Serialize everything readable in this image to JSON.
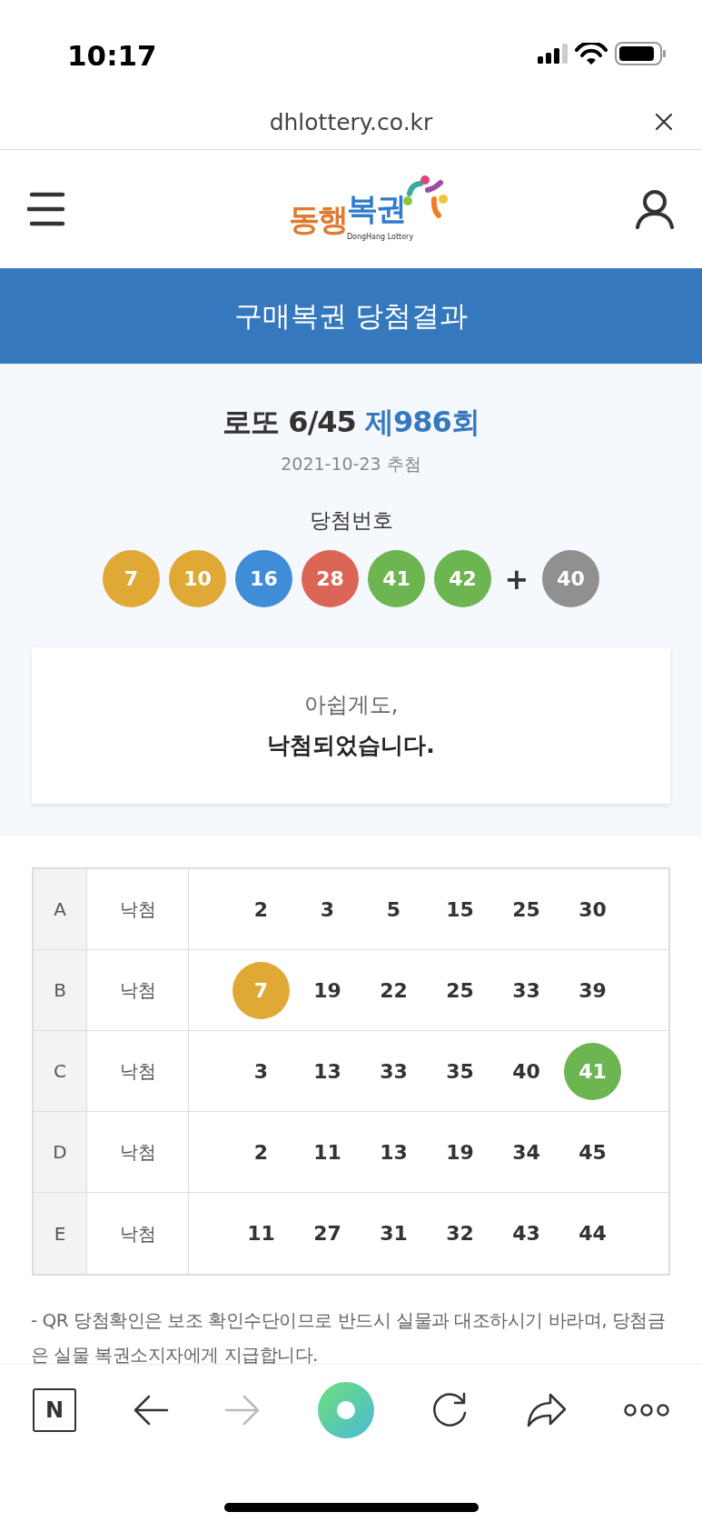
{
  "status_bar": {
    "time": "10:17"
  },
  "browser": {
    "url": "dhlottery.co.kr"
  },
  "header": {
    "logo_part_1": "동행",
    "logo_part_2": "복권",
    "logo_subtitle": "DongHang Lottery"
  },
  "banner": {
    "title": "구매복권 당첨결과"
  },
  "result": {
    "game": "로또 6/45",
    "round": "제986회",
    "date": "2021-10-23 추첨",
    "numbers_label": "당첨번호",
    "balls": [
      {
        "value": "7",
        "color": "#e0a935"
      },
      {
        "value": "10",
        "color": "#e0a935"
      },
      {
        "value": "16",
        "color": "#3f8dd6"
      },
      {
        "value": "28",
        "color": "#dc6656"
      },
      {
        "value": "41",
        "color": "#6db551"
      },
      {
        "value": "42",
        "color": "#6db551"
      }
    ],
    "plus": "+",
    "bonus": {
      "value": "40",
      "color": "#909090"
    },
    "message_line_1": "아쉽게도,",
    "message_line_2": "낙첨되었습니다."
  },
  "tickets": [
    {
      "game": "A",
      "status": "낙첨",
      "numbers": [
        {
          "value": "2",
          "matched": false
        },
        {
          "value": "3",
          "matched": false
        },
        {
          "value": "5",
          "matched": false
        },
        {
          "value": "15",
          "matched": false
        },
        {
          "value": "25",
          "matched": false
        },
        {
          "value": "30",
          "matched": false
        }
      ]
    },
    {
      "game": "B",
      "status": "낙첨",
      "numbers": [
        {
          "value": "7",
          "matched": true,
          "color": "#e0a935"
        },
        {
          "value": "19",
          "matched": false
        },
        {
          "value": "22",
          "matched": false
        },
        {
          "value": "25",
          "matched": false
        },
        {
          "value": "33",
          "matched": false
        },
        {
          "value": "39",
          "matched": false
        }
      ]
    },
    {
      "game": "C",
      "status": "낙첨",
      "numbers": [
        {
          "value": "3",
          "matched": false
        },
        {
          "value": "13",
          "matched": false
        },
        {
          "value": "33",
          "matched": false
        },
        {
          "value": "35",
          "matched": false
        },
        {
          "value": "40",
          "matched": false
        },
        {
          "value": "41",
          "matched": true,
          "color": "#6db551"
        }
      ]
    },
    {
      "game": "D",
      "status": "낙첨",
      "numbers": [
        {
          "value": "2",
          "matched": false
        },
        {
          "value": "11",
          "matched": false
        },
        {
          "value": "13",
          "matched": false
        },
        {
          "value": "19",
          "matched": false
        },
        {
          "value": "34",
          "matched": false
        },
        {
          "value": "45",
          "matched": false
        }
      ]
    },
    {
      "game": "E",
      "status": "낙첨",
      "numbers": [
        {
          "value": "11",
          "matched": false
        },
        {
          "value": "27",
          "matched": false
        },
        {
          "value": "31",
          "matched": false
        },
        {
          "value": "32",
          "matched": false
        },
        {
          "value": "43",
          "matched": false
        },
        {
          "value": "44",
          "matched": false
        }
      ]
    }
  ],
  "note": "- QR 당첨확인은 보조 확인수단이므로 반드시 실물과 대조하시기 바라며, 당첨금은 실물 복권소지자에게 지급합니다.",
  "toolbar": [
    {
      "kind": "naver",
      "label": "N",
      "disabled": false
    },
    {
      "kind": "back",
      "disabled": false
    },
    {
      "kind": "forward",
      "disabled": true
    },
    {
      "kind": "home",
      "disabled": false
    },
    {
      "kind": "reload",
      "disabled": false
    },
    {
      "kind": "share",
      "disabled": false
    },
    {
      "kind": "more",
      "disabled": false
    }
  ]
}
